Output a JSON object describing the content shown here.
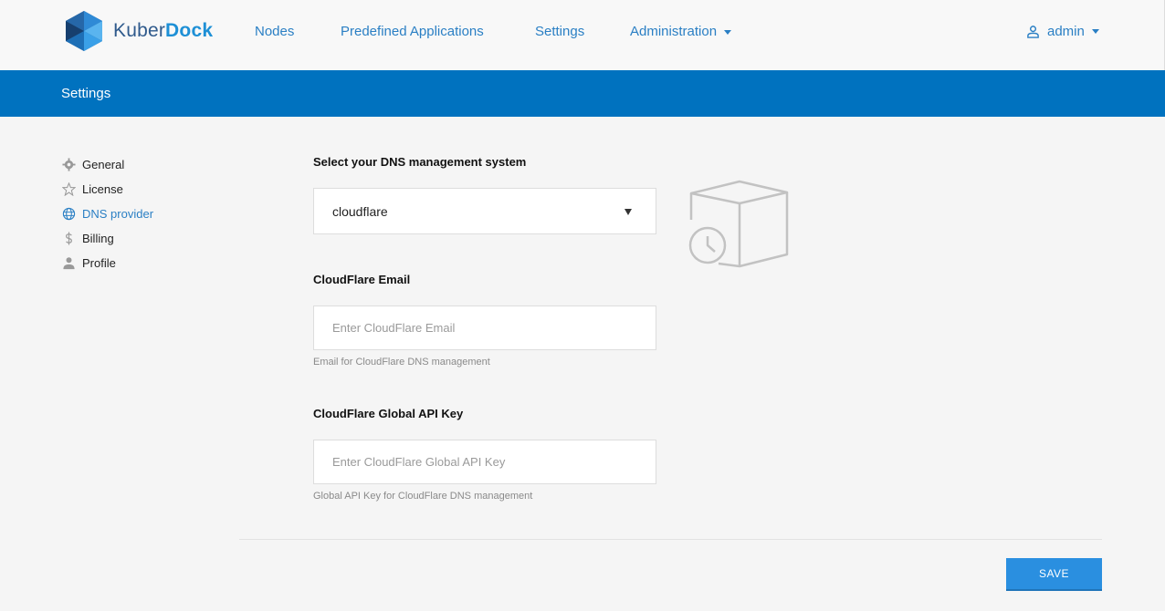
{
  "header": {
    "logo": {
      "part1": "Kuber",
      "part2": "Dock"
    },
    "nav": [
      "Nodes",
      "Predefined Applications",
      "Settings",
      "Administration"
    ],
    "user": "admin"
  },
  "page": {
    "title": "Settings"
  },
  "sidebar": {
    "items": [
      {
        "label": "General",
        "icon": "gear-icon"
      },
      {
        "label": "License",
        "icon": "star-icon"
      },
      {
        "label": "DNS provider",
        "icon": "globe-icon",
        "active": true
      },
      {
        "label": "Billing",
        "icon": "dollar-icon"
      },
      {
        "label": "Profile",
        "icon": "user-icon"
      }
    ]
  },
  "form": {
    "dns_label": "Select your DNS management system",
    "dns_value": "cloudflare",
    "email_label": "CloudFlare Email",
    "email_placeholder": "Enter CloudFlare Email",
    "email_help": "Email for CloudFlare DNS management",
    "key_label": "CloudFlare Global API Key",
    "key_placeholder": "Enter CloudFlare Global API Key",
    "key_help": "Global API Key for CloudFlare DNS management"
  },
  "actions": {
    "save": "SAVE"
  },
  "colors": {
    "accent": "#0072bf",
    "link": "#2a7fc4",
    "button": "#2a8fe0"
  }
}
